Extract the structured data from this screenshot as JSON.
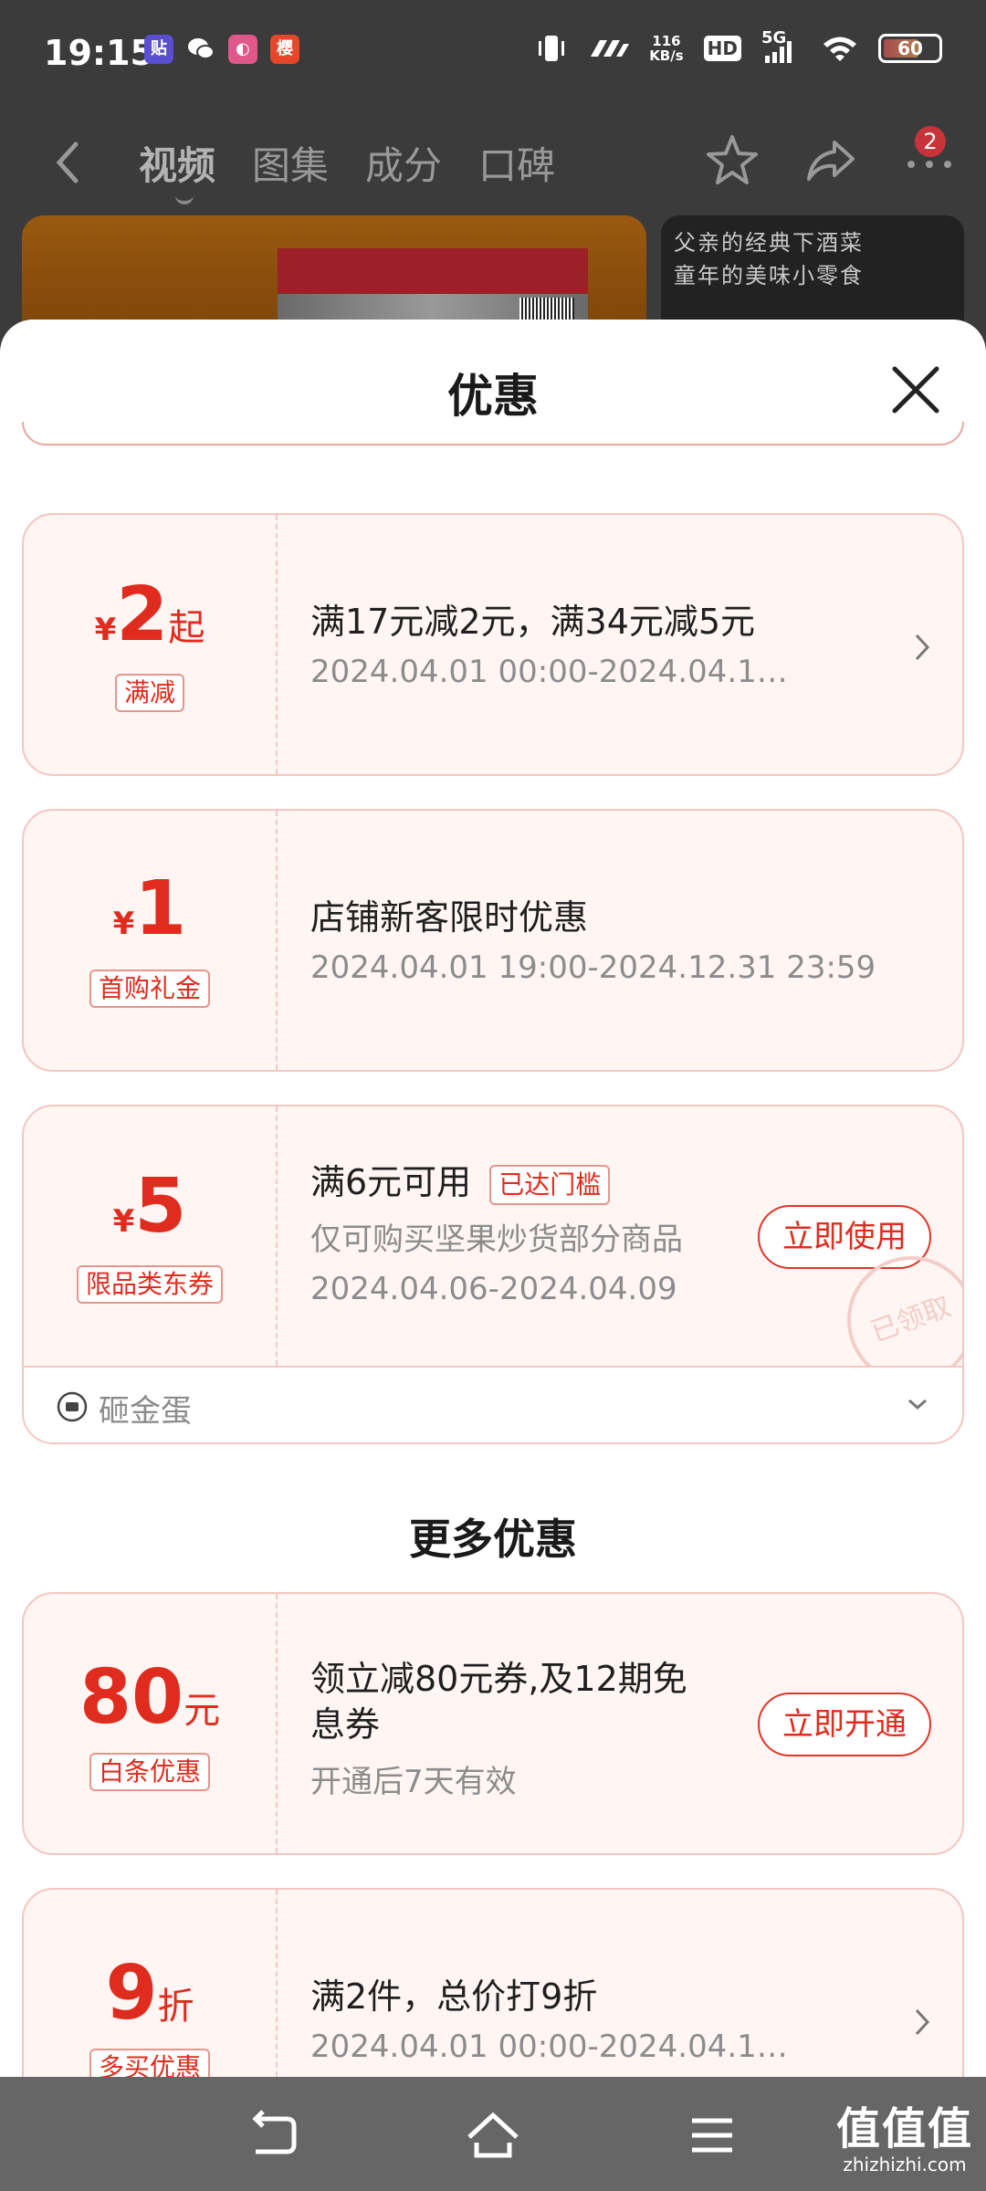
{
  "status_bar": {
    "time": "19:15",
    "net_speed_value": "116",
    "net_speed_unit": "KB/s",
    "hd_label": "HD",
    "network": "5G",
    "battery": "60",
    "app_icons": [
      "book-app-icon",
      "wechat-icon",
      "pink-app-icon",
      "orange-app-icon"
    ]
  },
  "top_nav": {
    "tabs": [
      "视频",
      "图集",
      "成分",
      "口碑"
    ],
    "active_tab": "视频",
    "badge_count": "2"
  },
  "banner_right_text": [
    "父亲的经典下酒菜",
    "童年的美味小零食"
  ],
  "sheet": {
    "title": "优惠",
    "coupons": [
      {
        "currency": "¥",
        "amount": "2",
        "suffix": "起",
        "tag": "满减",
        "title": "满17元减2元，满34元减5元",
        "date": "2024.04.01 00:00-2024.04.1…"
      },
      {
        "currency": "¥",
        "amount": "1",
        "tag": "首购礼金",
        "title": "店铺新客限时优惠",
        "date": "2024.04.01 19:00-2024.12.31 23:59"
      },
      {
        "currency": "¥",
        "amount": "5",
        "tag": "限品类东券",
        "title": "满6元可用",
        "status_tag": "已达门槛",
        "desc": "仅可购买坚果炒货部分商品",
        "date": "2024.04.06-2024.04.09",
        "button": "立即使用",
        "stamp": "已领取",
        "footer_label": "砸金蛋"
      }
    ],
    "more_section_title": "更多优惠",
    "more": [
      {
        "amount": "80",
        "suffix": "元",
        "tag": "白条优惠",
        "title_line1": "领立减80元券,及12期免",
        "title_line2": "息券",
        "desc": "开通后7天有效",
        "button": "立即开通"
      },
      {
        "amount": "9",
        "suffix": "折",
        "tag": "多买优惠",
        "title": "满2件，总价打9折",
        "date": "2024.04.01 00:00-2024.04.1…"
      }
    ]
  },
  "watermark": {
    "big": "值值值",
    "small": "zhizhizhi.com"
  }
}
